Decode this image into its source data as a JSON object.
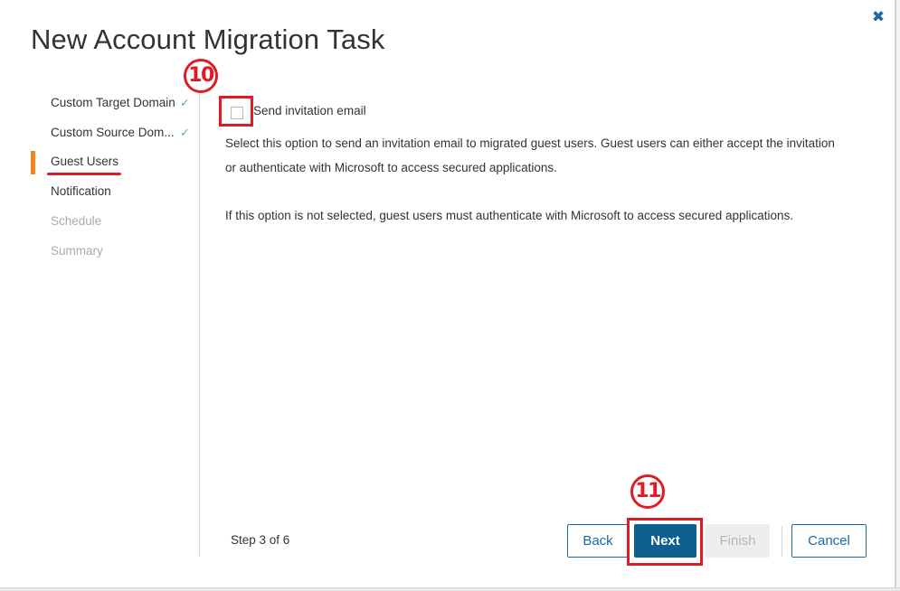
{
  "dialog": {
    "title": "New Account Migration Task",
    "close_icon": "close-icon"
  },
  "steps": [
    {
      "label": "Custom Target Domain",
      "state": "completed",
      "check": "✓"
    },
    {
      "label": "Custom Source Dom...",
      "state": "completed",
      "check": "✓"
    },
    {
      "label": "Guest Users",
      "state": "active"
    },
    {
      "label": "Notification",
      "state": "enabled"
    },
    {
      "label": "Schedule",
      "state": "disabled"
    },
    {
      "label": "Summary",
      "state": "disabled"
    }
  ],
  "guest_users": {
    "invite_checkbox_label": "Send invitation email",
    "invite_checked": false,
    "description_line1": "Select this option to send an invitation email to migrated guest users. Guest users can either accept the invitation",
    "description_line2": "or authenticate with Microsoft to access secured applications.",
    "note": "If this option is not selected, guest users must authenticate with Microsoft to access secured applications."
  },
  "annotations": {
    "marker_10": "10",
    "marker_11": "11"
  },
  "footer": {
    "step_counter": "Step 3 of 6",
    "back_label": "Back",
    "next_label": "Next",
    "finish_label": "Finish",
    "cancel_label": "Cancel"
  },
  "colors": {
    "accent": "#0f5f8f",
    "link": "#1a6aa8",
    "active_step": "#f5831f",
    "check": "#5cb85c",
    "annotation": "#e01b24"
  }
}
